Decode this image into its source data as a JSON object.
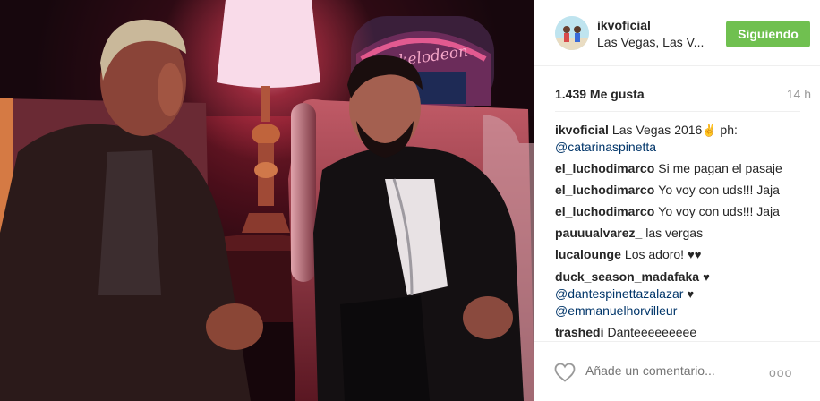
{
  "post": {
    "photo": {
      "description_icon": "photo-icon",
      "sign_text": "Nickelodeon"
    },
    "header": {
      "username": "ikvoficial",
      "location": "Las Vegas, Las V...",
      "follow_label": "Siguiendo",
      "follow_color": "#70c050"
    },
    "stats": {
      "likes": "1.439 Me gusta",
      "time": "14 h"
    },
    "comments": [
      {
        "user": "ikvoficial",
        "text": "Las Vegas 2016",
        "emoji": "✌",
        "extra": " ph:",
        "mention": "@catarinaspinetta"
      },
      {
        "user": "el_luchodimarco",
        "text": "Si me pagan el pasaje"
      },
      {
        "user": "el_luchodimarco",
        "text": "Yo voy con uds!!! Jaja"
      },
      {
        "user": "el_luchodimarco",
        "text": "Yo voy con uds!!! Jaja"
      },
      {
        "user": "pauuualvarez_",
        "text": "las vergas"
      },
      {
        "user": "lucalounge",
        "text": "Los adoro!",
        "emoji": "♥♥"
      },
      {
        "user": "duck_season_madafaka",
        "emoji": "♥",
        "mention": "@dantespinettazalazar",
        "mention_emoji": "♥",
        "mention2": "@emmanuelhorvilleur"
      },
      {
        "user": "trashedi",
        "text": "Danteeeeeeeee"
      }
    ],
    "add_comment": {
      "placeholder": "Añade un comentario...",
      "more": "ooo"
    }
  }
}
